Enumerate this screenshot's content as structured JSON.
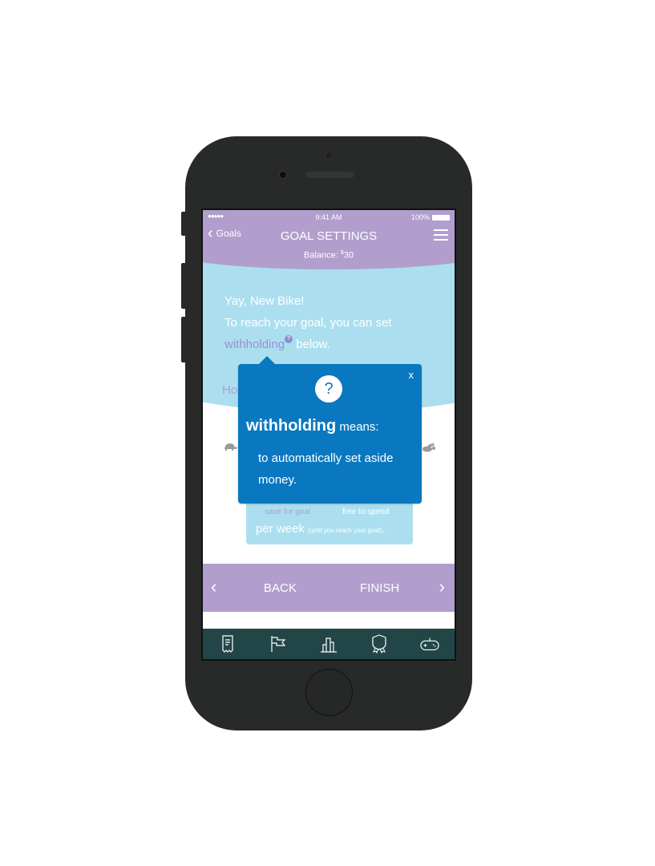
{
  "status_bar": {
    "signal": "●●●●●",
    "time": "9:41 AM",
    "battery": "100%"
  },
  "header": {
    "back_label": "Goals",
    "title": "GOAL SETTINGS",
    "balance_label": "Balance: ",
    "balance_currency": "$",
    "balance_value": "30"
  },
  "intro": {
    "line1": "Yay, New Bike!",
    "line2": "To reach your goal, you can set",
    "term": "withholding",
    "help_glyph": "?",
    "line3_suffix": " below."
  },
  "question_partial": "Ho",
  "slider": {
    "left_icon": "turtle-icon",
    "right_icon": "rabbit-icon"
  },
  "summary_card": {
    "save_label": "save for goal",
    "free_label": "free to spend",
    "per_week": "per week",
    "note": "(until you reach your goal)",
    "period": "."
  },
  "popup": {
    "icon": "?",
    "close": "x",
    "term": "withholding",
    "means": " means:",
    "definition": "to automatically set aside money."
  },
  "nav": {
    "back_label": "BACK",
    "finish_label": "FINISH",
    "prev_glyph": "‹",
    "next_glyph": "›"
  },
  "tabbar": {
    "items": [
      "receipt-icon",
      "flag-icon",
      "chart-icon",
      "badge-icon",
      "gamepad-icon"
    ]
  }
}
